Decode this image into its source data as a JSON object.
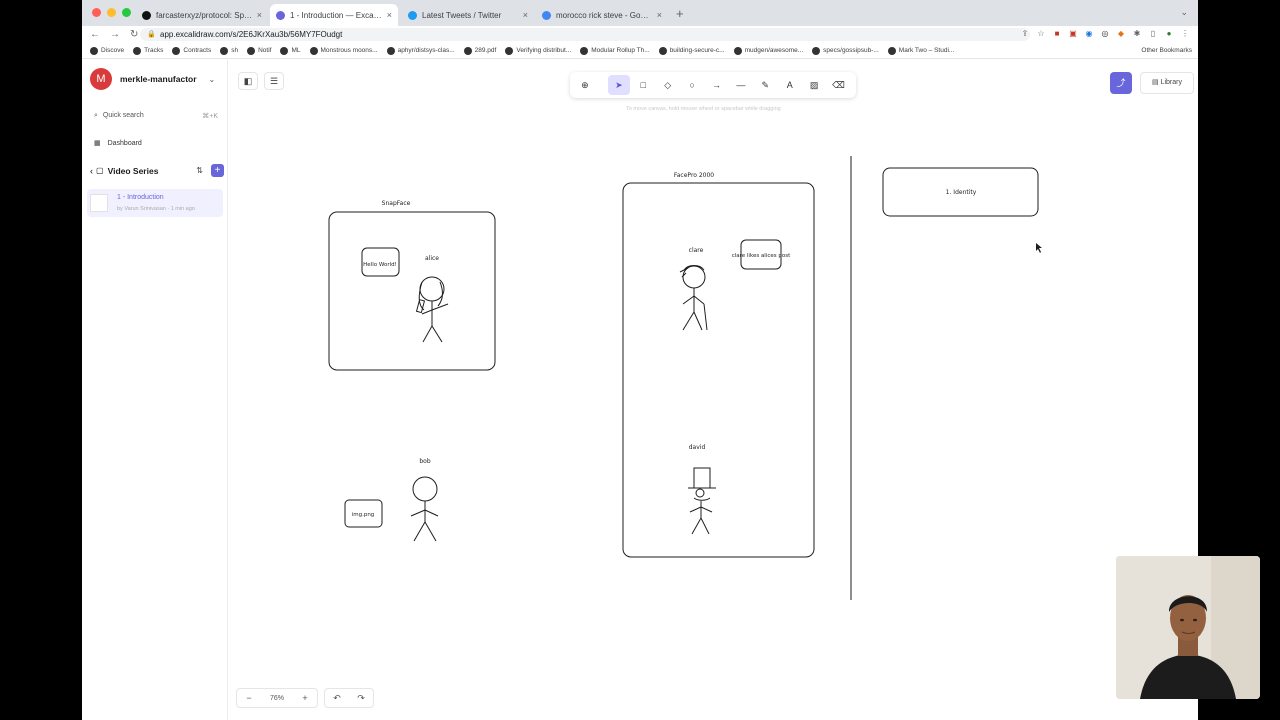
{
  "browser": {
    "tabs": [
      {
        "title": "farcasterxyz/protocol: Specifi...",
        "icon": "github-icon",
        "active": false
      },
      {
        "title": "1 - Introduction — Excalidraw Pl...",
        "icon": "excalidraw-icon",
        "active": true
      },
      {
        "title": "Latest Tweets / Twitter",
        "icon": "twitter-icon",
        "active": false
      },
      {
        "title": "morocco rick steve - Google Se...",
        "icon": "google-icon",
        "active": false
      }
    ],
    "url": "app.excalidraw.com/s/2E6JKrXau3b/56MY7FOudgt",
    "bookmarks": [
      "Discove",
      "Tracks",
      "Contracts",
      "sh",
      "Notif",
      "ML",
      "Monstrous moons...",
      "aphyr/distsys-clas...",
      "289.pdf",
      "Verifying distribut...",
      "Modular Rollup Th...",
      "building-secure-c...",
      "mudgen/awesome...",
      "specs/gossipsub-...",
      "Mark Two – Studi..."
    ],
    "other_bookmarks": "Other Bookmarks"
  },
  "sidebar": {
    "avatar_letter": "M",
    "workspace": "merkle-manufactor",
    "search_placeholder": "Quick search",
    "search_shortcut": "⌘+K",
    "dashboard": "Dashboard",
    "collection": "Video Series",
    "scene": {
      "name": "1 - Introduction",
      "meta": "by Varun Srinivasan · 1 min ago"
    }
  },
  "toolbar": {
    "tools": [
      "lock",
      "selection",
      "rectangle",
      "diamond",
      "ellipse",
      "arrow",
      "line",
      "draw",
      "text",
      "image",
      "eraser"
    ],
    "selected": "selection",
    "hint": "To move canvas, hold mouse wheel or spacebar while dragging"
  },
  "top_right": {
    "library": "Library"
  },
  "footer": {
    "zoom": "76%"
  },
  "drawing": {
    "labels": {
      "snapface": "SnapFace",
      "facepro": "FacePro 2000",
      "identity": "1. Identity",
      "hello": "Hello World!",
      "alice": "alice",
      "clare": "clare",
      "clare_likes": "clare likes alices post",
      "bob": "bob",
      "img": "img.png",
      "david": "david"
    }
  },
  "colors": {
    "accent": "#6965db",
    "avatar": "#d93b3b"
  }
}
